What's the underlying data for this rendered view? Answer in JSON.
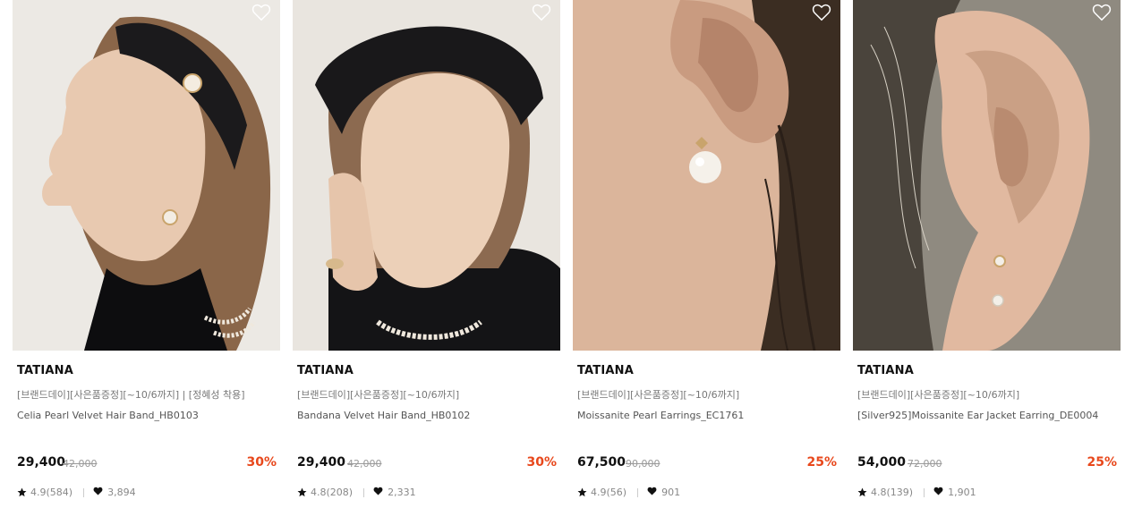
{
  "products": [
    {
      "brand": "TATIANA",
      "promo": "[브랜드데이][사은품증정][~10/6까지] | [정혜성 착용]",
      "name": "Celia Pearl Velvet Hair Band_HB0103",
      "price": "29,400",
      "original_price": "42,000",
      "discount": "30%",
      "rating": "4.9(584)",
      "likes": "3,894",
      "image_subject": "model profile wearing black velvet hair band with pearl brooch"
    },
    {
      "brand": "TATIANA",
      "promo": "[브랜드데이][사은품증정][~10/6까지]",
      "name": "Bandana Velvet Hair Band_HB0102",
      "price": "29,400",
      "original_price": "42,000",
      "discount": "30%",
      "rating": "4.8(208)",
      "likes": "2,331",
      "image_subject": "model resting face on hand wearing black velvet bandana hair band"
    },
    {
      "brand": "TATIANA",
      "promo": "[브랜드데이][사은품증정][~10/6까지]",
      "name": "Moissanite Pearl Earrings_EC1761",
      "price": "67,500",
      "original_price": "90,000",
      "discount": "25%",
      "rating": "4.9(56)",
      "likes": "901",
      "image_subject": "close-up of ear with pearl drop earring"
    },
    {
      "brand": "TATIANA",
      "promo": "[브랜드데이][사은품증정][~10/6까지]",
      "name": "[Silver925]Moissanite Ear Jacket Earring_DE0004",
      "price": "54,000",
      "original_price": "72,000",
      "discount": "25%",
      "rating": "4.8(139)",
      "likes": "1,901",
      "image_subject": "close-up of ear with moissanite ear jacket earring"
    }
  ],
  "icons": {
    "wishlist": "heart-outline-icon",
    "rating": "star-icon",
    "likes": "heart-filled-icon"
  },
  "colors": {
    "discount": "#e8481c",
    "price": "#111111",
    "original_price": "#999999"
  }
}
